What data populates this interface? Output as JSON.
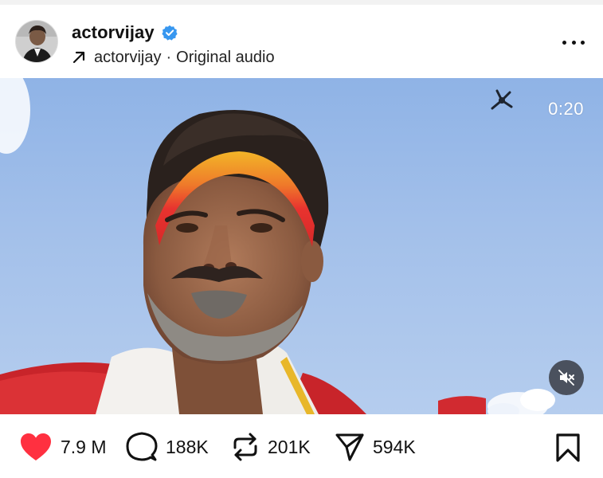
{
  "post": {
    "username": "actorvijay",
    "verified": true,
    "audio_author": "actorvijay",
    "audio_separator": "·",
    "audio_title": "Original audio",
    "more_icon": "more-horizontal-icon"
  },
  "video": {
    "timestamp": "0:20",
    "muted": true,
    "mute_icon": "speaker-muted-icon"
  },
  "actions": {
    "likes": "7.9 M",
    "comments": "188K",
    "reposts": "201K",
    "shares": "594K",
    "liked": true
  },
  "colors": {
    "like_red": "#ff3040",
    "verified_blue": "#3797f0",
    "sky": "#a3c0ea",
    "headband_red": "#e8332f",
    "headband_yellow": "#f2b528"
  },
  "icons": {
    "like": "heart-icon",
    "comment": "comment-bubble-icon",
    "repost": "repost-icon",
    "share": "paper-plane-icon",
    "save": "bookmark-icon",
    "verified": "verified-badge-icon",
    "audio": "arrow-up-right-icon"
  }
}
